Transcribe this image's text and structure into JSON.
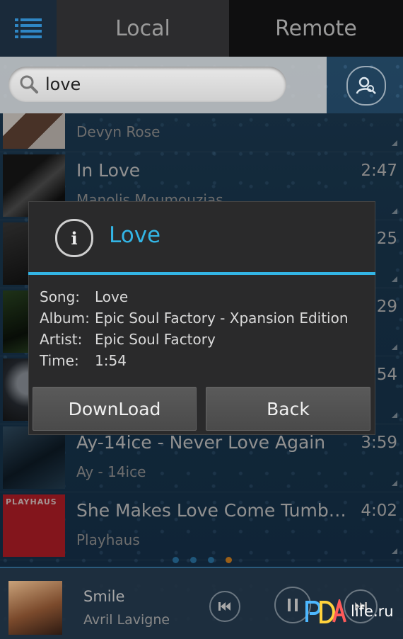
{
  "tabs": {
    "local": "Local",
    "remote": "Remote"
  },
  "search": {
    "query": "love"
  },
  "songs": [
    {
      "title": "",
      "artist": "Devyn Rose",
      "duration": ""
    },
    {
      "title": "In Love",
      "artist": "Manolis Moumouzias",
      "duration": "2:47"
    },
    {
      "title": "",
      "artist": "",
      "duration": "25"
    },
    {
      "title": "",
      "artist": "",
      "duration": "29"
    },
    {
      "title": "",
      "artist": "",
      "duration": "54"
    },
    {
      "title": "Ay-14ice - Never Love Again",
      "artist": "Ay - 14ice",
      "duration": "3:59"
    },
    {
      "title": "She Makes Love Come Tumbli...",
      "artist": "Playhaus",
      "duration": "4:02",
      "thumb_text": "PLAYHAUS"
    }
  ],
  "dialog": {
    "title": "Love",
    "fields": [
      {
        "label": "Song:",
        "value": "Love"
      },
      {
        "label": "Album:",
        "value": "Epic Soul Factory - Xpansion Edition"
      },
      {
        "label": "Artist:",
        "value": "Epic Soul Factory"
      },
      {
        "label": "Time:",
        "value": "1:54"
      }
    ],
    "download_label": "DownLoad",
    "back_label": "Back"
  },
  "now_playing": {
    "title": "Smile",
    "artist": "Avril Lavigne"
  },
  "watermark": {
    "text": "life.ru"
  },
  "colors": {
    "accent": "#33b5e5",
    "active_dot": "#e38d24",
    "dot": "#2f7fb4"
  }
}
